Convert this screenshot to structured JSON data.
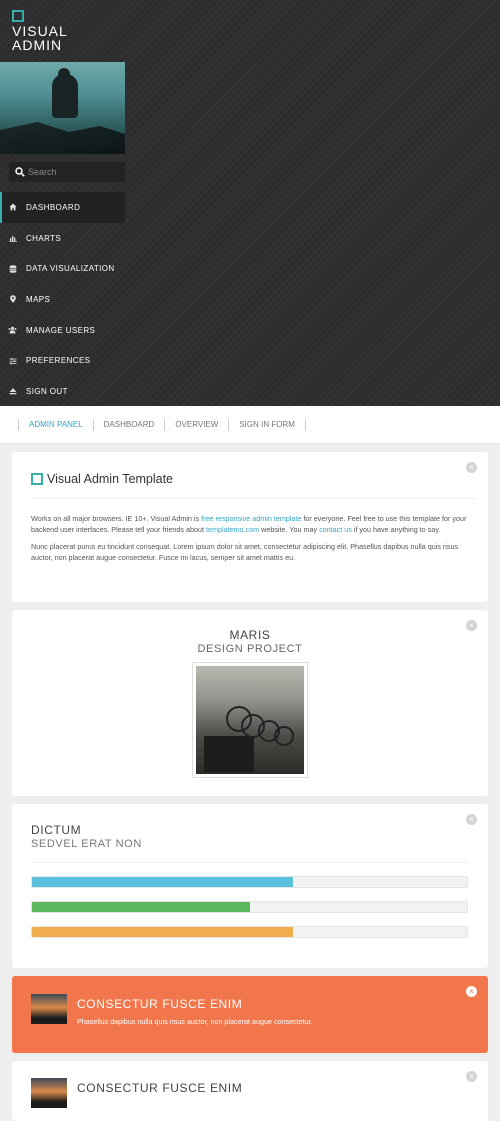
{
  "brand": {
    "line1": "VISUAL",
    "line2": "ADMIN"
  },
  "search": {
    "placeholder": "Search"
  },
  "nav": {
    "items": [
      {
        "label": "DASHBOARD",
        "icon": "home-icon"
      },
      {
        "label": "CHARTS",
        "icon": "bar-chart-icon"
      },
      {
        "label": "DATA VISUALIZATION",
        "icon": "database-icon"
      },
      {
        "label": "MAPS",
        "icon": "map-marker-icon"
      },
      {
        "label": "MANAGE USERS",
        "icon": "users-icon"
      },
      {
        "label": "PREFERENCES",
        "icon": "sliders-icon"
      },
      {
        "label": "SIGN OUT",
        "icon": "eject-icon"
      }
    ]
  },
  "breadcrumb": [
    "ADMIN PANEL",
    "DASHBOARD",
    "OVERVIEW",
    "SIGN IN FORM"
  ],
  "intro_panel": {
    "title": "Visual Admin Template",
    "p1_a": "Works on all major browsers. IE 10+. Visual Admin is ",
    "p1_link1": "free responsive admin template",
    "p1_b": " for everyone. Feel free to use this template for your backend user interfaces. Please tell your friends about ",
    "p1_link2": "templatemo.com",
    "p1_c": " website. You may ",
    "p1_link3": "contact us",
    "p1_d": " if you have anything to say.",
    "p2": "Nunc placerat purus eu tincidunt consequat. Lorem ipsum dolor sit amet, consectetur adipiscing elit. Phasellus dapibus nulla quis risus auctor, non placerat augue consectetur. Fusce mi lacus, semper sit amet mattis eu."
  },
  "profile_panel": {
    "title": "MARIS",
    "subtitle": "DESIGN PROJECT"
  },
  "progress_panel": {
    "title": "DICTUM",
    "subtitle": "SEDVEL ERAT NON",
    "bars": [
      {
        "value": 60,
        "color": "#5bc0de"
      },
      {
        "value": 50,
        "color": "#5cb85c"
      },
      {
        "value": 60,
        "color": "#f0ad4e"
      }
    ]
  },
  "highlight_panel": {
    "title": "CONSECTUR FUSCE ENIM",
    "text": "Phasellus dapibus nulla quis risus auctor, non placerat augue consectetur.",
    "color": "#f2764c"
  },
  "bottom_panel": {
    "title": "CONSECTUR FUSCE ENIM"
  },
  "colors": {
    "accent": "#39ada7",
    "link": "#39a3c4",
    "sidebar": "#2d2d30"
  }
}
